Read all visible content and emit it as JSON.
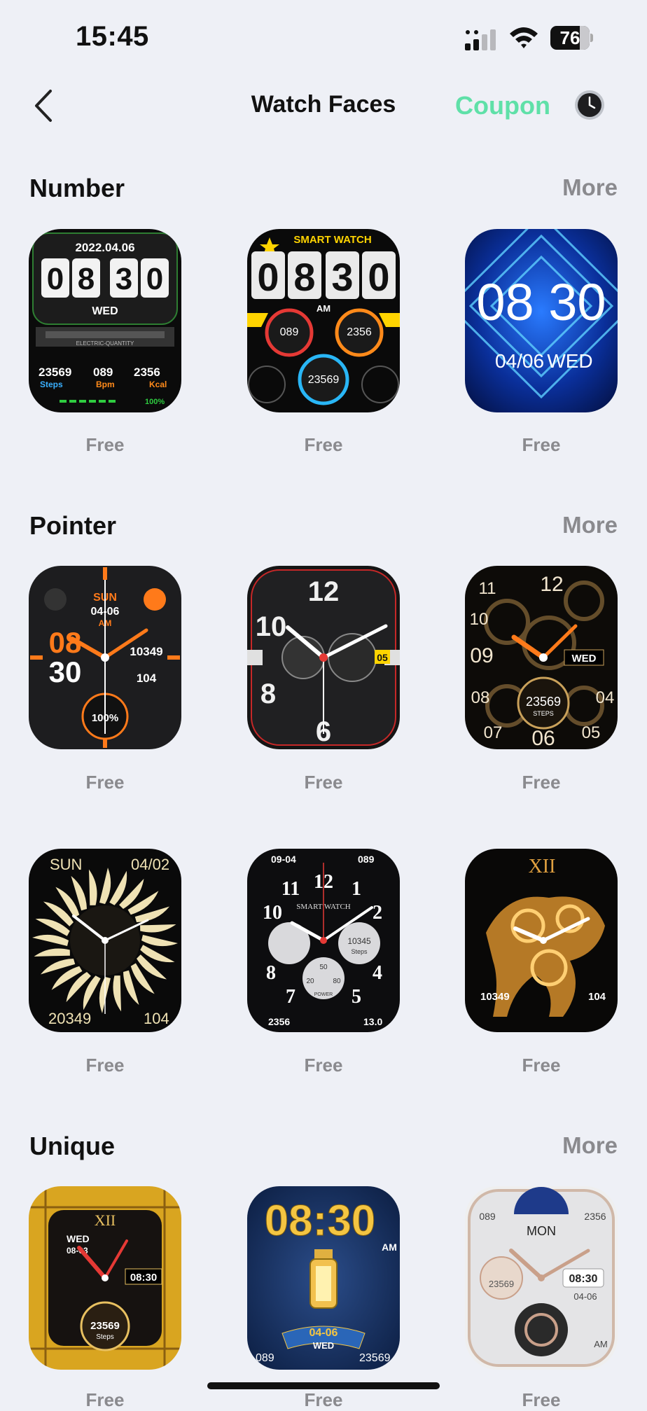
{
  "status_bar": {
    "time": "15:45",
    "battery": "76"
  },
  "nav": {
    "title": "Watch Faces",
    "coupon": "Coupon"
  },
  "sections": [
    {
      "title": "Number",
      "more": "More",
      "faces": [
        {
          "price": "Free",
          "date": "2022.04.06",
          "digits": [
            "0",
            "8",
            "3",
            "0"
          ],
          "day": "WED",
          "band": "ELECTRIC-QUANTITY",
          "stats": [
            "23569",
            "089",
            "2356"
          ],
          "stat_labels": [
            "Steps",
            "Bpm",
            "Kcal"
          ],
          "battery": "100%"
        },
        {
          "price": "Free",
          "brand": "SMART WATCH",
          "digits": [
            "0",
            "8",
            "3",
            "0"
          ],
          "ampm": "AM",
          "gauges": [
            "089",
            "2356",
            "23569"
          ]
        },
        {
          "price": "Free",
          "time": "08 30",
          "date": "04/06",
          "day": "WED"
        }
      ]
    },
    {
      "title": "Pointer",
      "more": "More",
      "faces": [
        {
          "price": "Free",
          "day": "SUN",
          "date": "04-06",
          "ampm": "AM",
          "hour": "08",
          "minute": "30",
          "steps": "10349",
          "heart": "104",
          "battery": "100%"
        },
        {
          "price": "Free",
          "numerals": [
            "12",
            "6",
            "10",
            "8"
          ],
          "badge": "05"
        },
        {
          "price": "Free",
          "numerals": [
            "12",
            "11",
            "10",
            "09",
            "08",
            "07",
            "06",
            "05",
            "04"
          ],
          "day": "WED",
          "steps": "23569",
          "steps_label": "STEPS"
        },
        {
          "price": "Free",
          "day": "SUN",
          "date": "04/02",
          "steps": "20349",
          "heart": "104"
        },
        {
          "price": "Free",
          "date": "09-04",
          "heart": "089",
          "brand": "SMART WATCH",
          "numerals": [
            "12",
            "11",
            "1",
            "10",
            "2",
            "8",
            "4",
            "7",
            "5"
          ],
          "steps": "10345",
          "steps_label": "Steps",
          "sub_dial": [
            "50",
            "20",
            "80"
          ],
          "power": "POWER",
          "bottom_left": "2356",
          "bottom_right": "13.0"
        },
        {
          "price": "Free",
          "numeral": "XII",
          "steps": "10349",
          "heart": "104"
        }
      ]
    },
    {
      "title": "Unique",
      "more": "More",
      "faces": [
        {
          "price": "Free",
          "numeral": "XII",
          "day": "WED",
          "date": "08-03",
          "time": "08:30",
          "steps": "23569",
          "steps_label": "Steps"
        },
        {
          "price": "Free",
          "time": "08:30",
          "ampm": "AM",
          "date": "04-06",
          "day": "WED",
          "heart": "089",
          "steps": "23569"
        },
        {
          "price": "Free",
          "corner_left": "089",
          "corner_right": "2356",
          "day": "MON",
          "steps": "23569",
          "time": "08:30",
          "date": "04-06",
          "ampm": "AM"
        }
      ]
    }
  ]
}
